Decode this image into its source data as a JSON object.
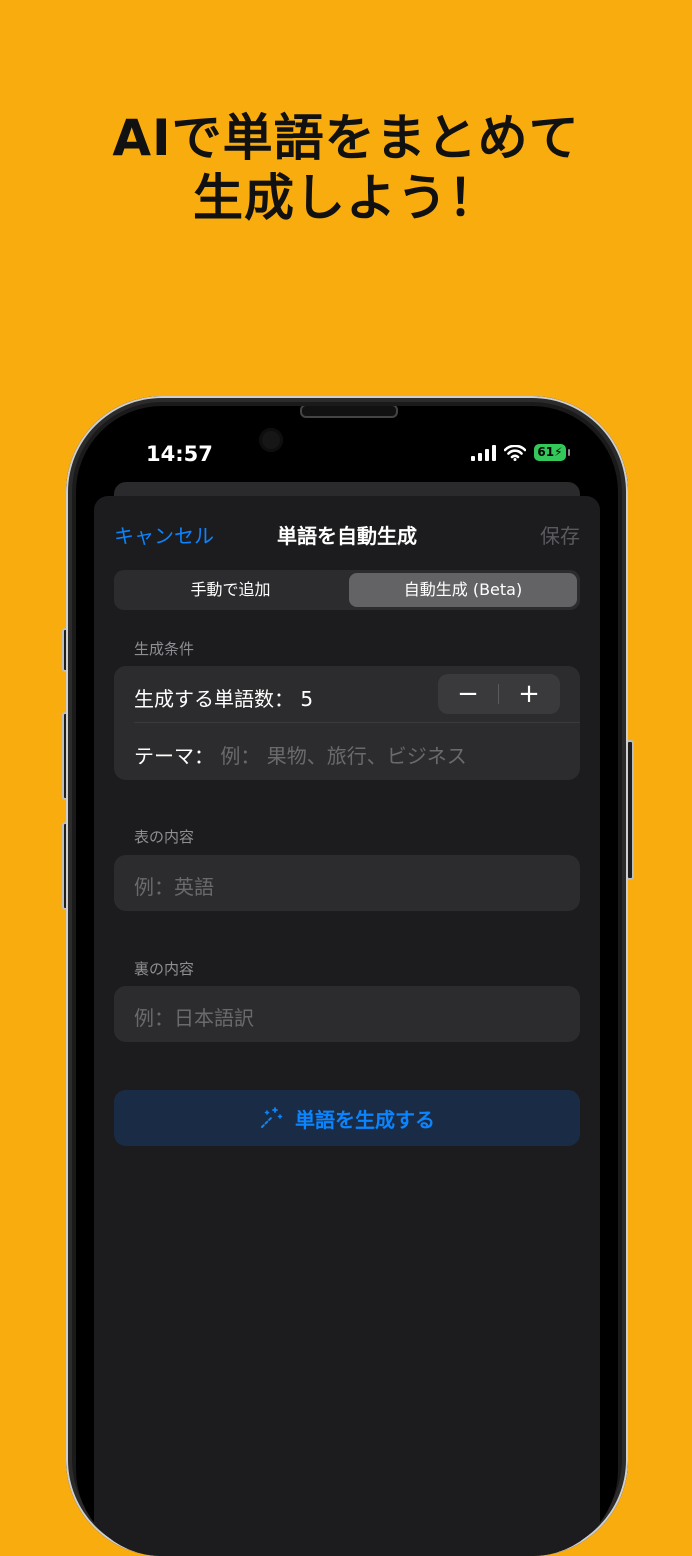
{
  "headline": {
    "line1": "AIで単語をまとめて",
    "line2": "生成しよう！"
  },
  "status_bar": {
    "time": "14:57",
    "battery": "61",
    "icons": [
      "cellular-icon",
      "wifi-icon",
      "battery-icon"
    ]
  },
  "nav": {
    "cancel": "キャンセル",
    "title": "単語を自動生成",
    "save": "保存"
  },
  "segment": {
    "manual": "手動で追加",
    "auto": "自動生成 (Beta)",
    "selected": "auto"
  },
  "conditions": {
    "header": "生成条件",
    "count_label": "生成する単語数：",
    "count_value": "5",
    "minus": "−",
    "plus": "+",
    "theme_label": "テーマ：",
    "theme_placeholder": "例：  果物、旅行、ビジネス"
  },
  "front": {
    "header": "表の内容",
    "placeholder": "例：英語"
  },
  "back": {
    "header": "裏の内容",
    "placeholder": "例：日本語訳"
  },
  "generate": {
    "label": "単語を生成する",
    "icon": "magic-wand-icon"
  },
  "colors": {
    "background": "#F8AC0D",
    "accent": "#0A84FF",
    "sheet": "#1C1C1E",
    "card": "#2C2C2E",
    "battery": "#34C759"
  }
}
